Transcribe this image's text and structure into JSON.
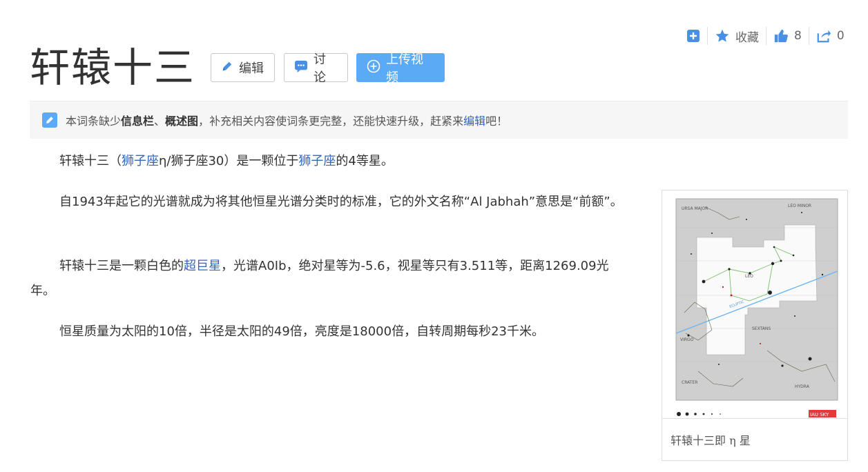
{
  "actions": {
    "add_label": "",
    "favorite_label": "收藏",
    "like_count": "8",
    "share_count": "0"
  },
  "title": "轩辕十三",
  "buttons": {
    "edit": "编辑",
    "discuss": "讨论",
    "upload_video": "上传视频"
  },
  "notice": {
    "prefix": "本词条缺少",
    "bold1": "信息栏",
    "sep": "、",
    "bold2": "概述图",
    "middle": "，补充相关内容使词条更完整，还能快速升级，赶紧来",
    "link": "编辑",
    "suffix": "吧！"
  },
  "paragraphs": {
    "p1": {
      "t1": "轩辕十三（",
      "l1": "狮子座",
      "t2": "η/狮子座30）是一颗位于",
      "l2": "狮子座",
      "t3": "的4等星。"
    },
    "p2": "自1943年起它的光谱就成为将其他恒星光谱分类时的标准，它的外文名称“Al Jabhah”意思是“前额”。",
    "p3": {
      "t1": "轩辕十三是一颗白色的",
      "l1": "超巨星",
      "t2": "，光谱A0Ib，绝对星等为-5.6，视星等只有3.511等，距离1269.09光年。"
    },
    "p4": "恒星质量为太阳的10倍，半径是太阳的49倍，亮度是18000倍，自转周期每秒23千米。"
  },
  "image_card": {
    "caption": "轩辕十三即 η 星",
    "map_labels": {
      "top_left": "URSA MAJOR",
      "top_right": "LEO MINOR",
      "leo": "LEO",
      "sextans": "SEXTANS",
      "virgo": "VIRGO",
      "crater": "CRATER",
      "hydra": "HYDRA",
      "ecliptic": "ECLIPTIC",
      "brand": "IAU SKY"
    }
  },
  "colors": {
    "accent": "#5aaaf5",
    "link": "#3366bb",
    "notice_bg": "#f6f6f6"
  }
}
